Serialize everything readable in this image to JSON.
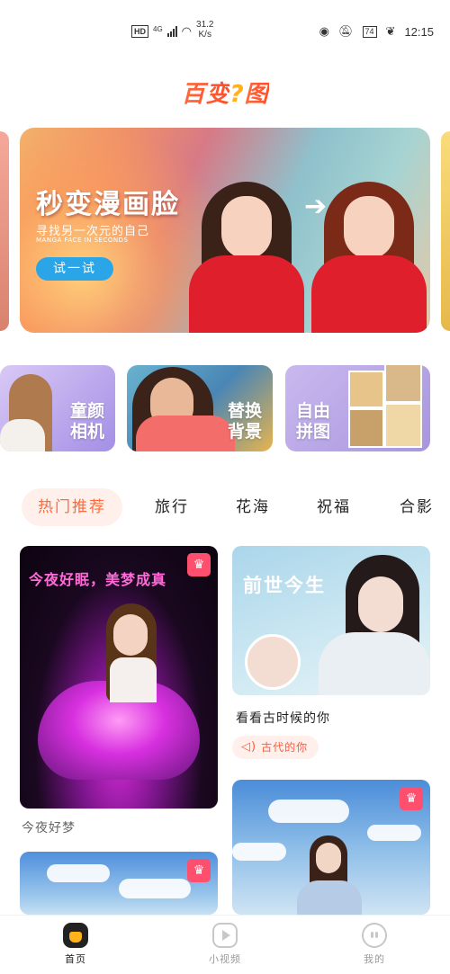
{
  "status_bar": {
    "hd": "HD",
    "network": "4G",
    "speed_value": "31.2",
    "speed_unit": "K/s",
    "battery": "74",
    "time": "12:15"
  },
  "app": {
    "logo_part1": "百变",
    "logo_q": "?",
    "logo_part2": "图"
  },
  "banner": {
    "title": "秒变漫画脸",
    "subtitle": "寻找另一次元的自己",
    "subtitle_en": "MANGA FACE IN SECONDS",
    "button": "试一试"
  },
  "feature_tiles": [
    {
      "label": "童颜\n相机"
    },
    {
      "label": "替换\n背景"
    },
    {
      "label": "自由\n拼图"
    }
  ],
  "category_tabs": [
    "热门推荐",
    "旅行",
    "花海",
    "祝福",
    "合影"
  ],
  "cards": {
    "c1": {
      "title": "今夜好眠，美梦成真",
      "caption": "今夜好梦"
    },
    "c2": {
      "title": "前世今生",
      "caption": "看看古时候的你",
      "tag": "古代的你"
    }
  },
  "bottom_nav": [
    {
      "label": "首页",
      "active": true
    },
    {
      "label": "小视频",
      "active": false
    },
    {
      "label": "我的",
      "active": false
    }
  ],
  "colors": {
    "accent": "#ff6a3a",
    "crown": "#ff4f6e",
    "try_button": "#2aa5e8"
  }
}
